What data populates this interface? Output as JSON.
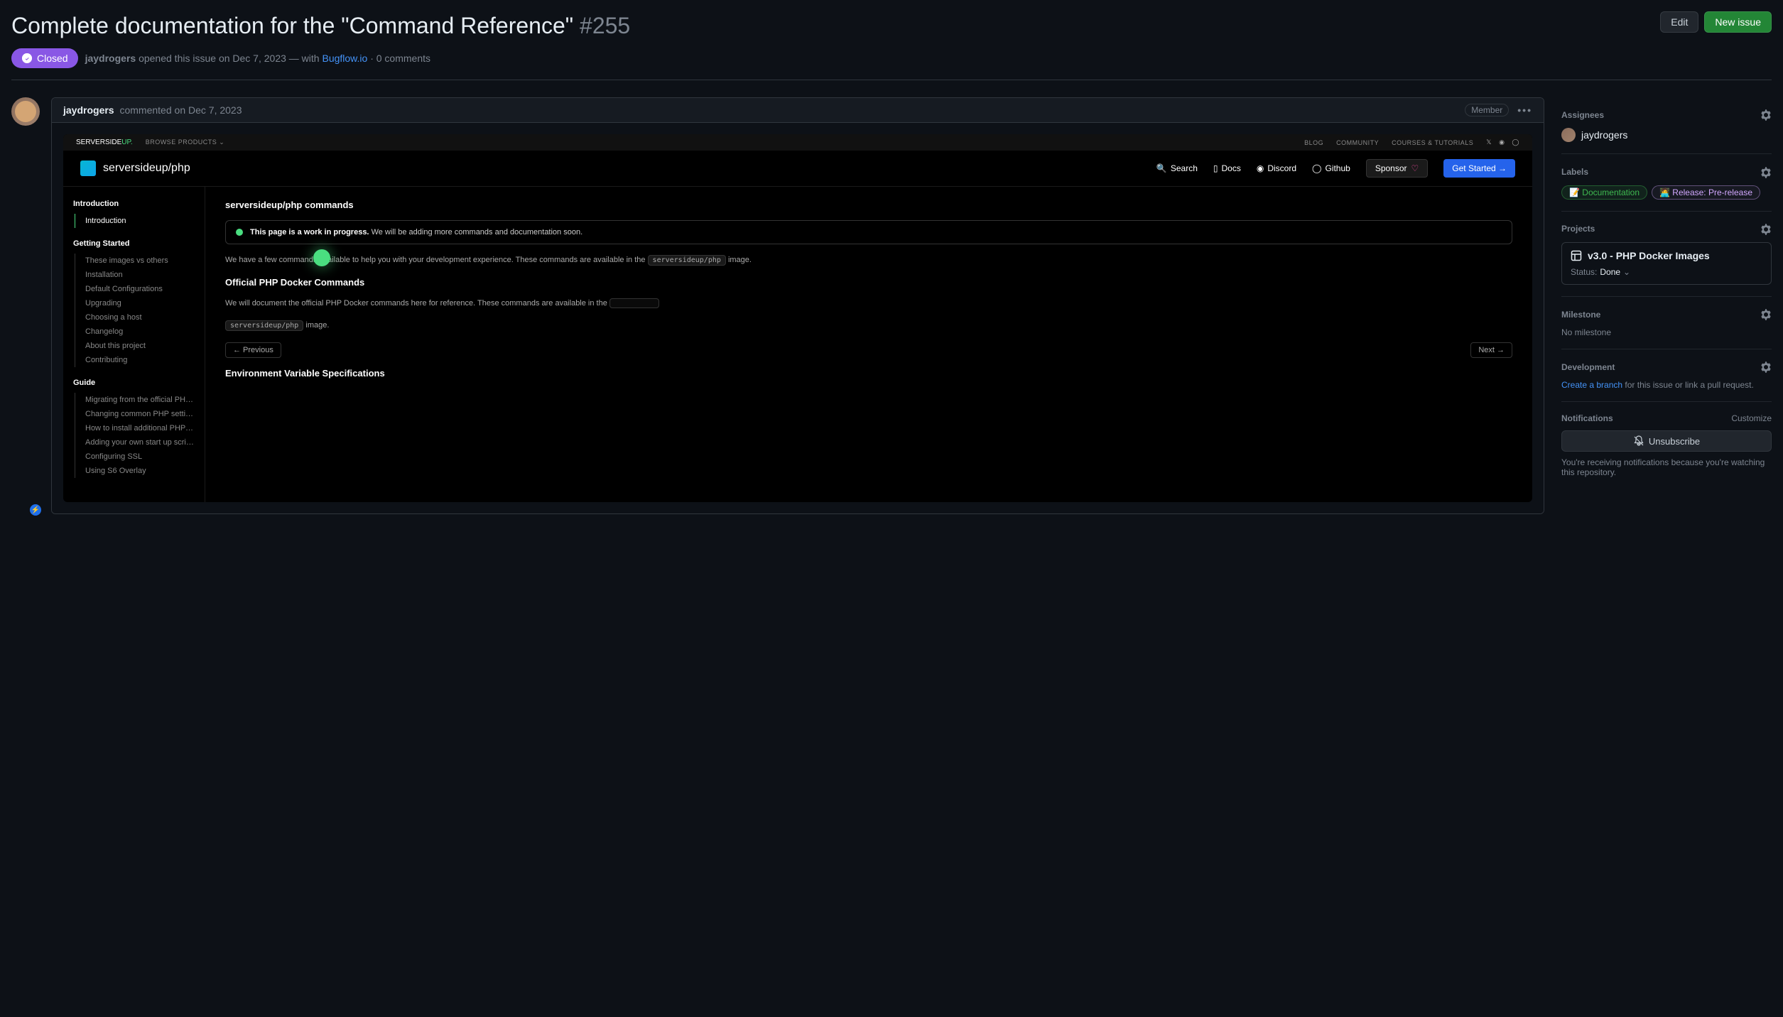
{
  "issue": {
    "title": "Complete documentation for the \"Command Reference\"",
    "number": "#255",
    "status": "Closed",
    "author": "jaydrogers",
    "opened_text": "opened this issue",
    "opened_date": "on Dec 7, 2023",
    "with_text": "— with",
    "with_link": "Bugflow.io",
    "comments_count": "· 0 comments"
  },
  "buttons": {
    "edit": "Edit",
    "new_issue": "New issue"
  },
  "comment": {
    "author": "jaydrogers",
    "verb": "commented",
    "date": "on Dec 7, 2023",
    "badge": "Member"
  },
  "embedded": {
    "topbar": {
      "logo_a": "ServerSide",
      "logo_b": "UP.",
      "browse": "BROWSE PRODUCTS",
      "links": [
        "BLOG",
        "COMMUNITY",
        "COURSES & TUTORIALS"
      ]
    },
    "brand": "serversideup/php",
    "nav": {
      "search": "Search",
      "docs": "Docs",
      "discord": "Discord",
      "github": "Github",
      "sponsor": "Sponsor",
      "getstarted": "Get Started →"
    },
    "sidebar": {
      "s1": {
        "title": "Introduction",
        "items": [
          "Introduction"
        ]
      },
      "s2": {
        "title": "Getting Started",
        "items": [
          "These images vs others",
          "Installation",
          "Default Configurations",
          "Upgrading",
          "Choosing a host",
          "Changelog",
          "About this project",
          "Contributing"
        ]
      },
      "s3": {
        "title": "Guide",
        "items": [
          "Migrating from the official PHP im...",
          "Changing common PHP settings",
          "How to install additional PHP exte...",
          "Adding your own start up scripts",
          "Configuring SSL",
          "Using S6 Overlay"
        ]
      }
    },
    "content": {
      "h1": "serversideup/php commands",
      "alert_strong": "This page is a work in progress.",
      "alert_rest": "We will be adding more commands and documentation soon.",
      "p1a": "We have a few commands available to help you with your development experience. These commands are available in the",
      "p1code": "serversideup/php",
      "p1b": "image.",
      "h2": "Official PHP Docker Commands",
      "p2a": "We will document the official PHP Docker commands here for reference. These commands are available in the",
      "p2code": "serversideup/php",
      "p2b": "image.",
      "prev": "← Previous",
      "next": "Next →",
      "h3": "Environment Variable Specifications"
    }
  },
  "sidebar": {
    "assignees": {
      "title": "Assignees",
      "user": "jaydrogers"
    },
    "labels": {
      "title": "Labels",
      "doc": "📝 Documentation",
      "rel": "🧑‍💻 Release: Pre-release"
    },
    "projects": {
      "title": "Projects",
      "name": "v3.0 - PHP Docker Images",
      "status_label": "Status:",
      "status_value": "Done"
    },
    "milestone": {
      "title": "Milestone",
      "value": "No milestone"
    },
    "development": {
      "title": "Development",
      "link": "Create a branch",
      "rest": "for this issue or link a pull request."
    },
    "notifications": {
      "title": "Notifications",
      "customize": "Customize",
      "unsubscribe": "Unsubscribe",
      "reason": "You're receiving notifications because you're watching this repository."
    }
  }
}
